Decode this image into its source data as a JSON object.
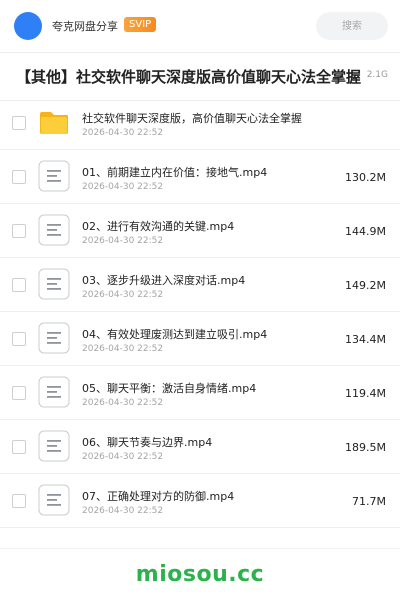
{
  "header": {
    "brand": "夸克网盘分享",
    "badge": "SVIP",
    "search_placeholder": "搜索"
  },
  "title": {
    "text": "【其他】社交软件聊天深度版高价值聊天心法全掌握",
    "total_size": "2.1G"
  },
  "rows": [
    {
      "name": "社交软件聊天深度版，高价值聊天心法全掌握",
      "date": "2026-04-30 22:52",
      "size": "",
      "icon": "folder-icon"
    },
    {
      "name": "01、前期建立内在价值：接地气.mp4",
      "date": "2026-04-30 22:52",
      "size": "130.2M",
      "icon": "document-icon"
    },
    {
      "name": "02、进行有效沟通的关键.mp4",
      "date": "2026-04-30 22:52",
      "size": "144.9M",
      "icon": "document-icon"
    },
    {
      "name": "03、逐步升级进入深度对话.mp4",
      "date": "2026-04-30 22:52",
      "size": "149.2M",
      "icon": "document-icon"
    },
    {
      "name": "04、有效处理废测达到建立吸引.mp4",
      "date": "2026-04-30 22:52",
      "size": "134.4M",
      "icon": "document-icon"
    },
    {
      "name": "05、聊天平衡：激活自身情绪.mp4",
      "date": "2026-04-30 22:52",
      "size": "119.4M",
      "icon": "document-icon"
    },
    {
      "name": "06、聊天节奏与边界.mp4",
      "date": "2026-04-30 22:52",
      "size": "189.5M",
      "icon": "document-icon"
    },
    {
      "name": "07、正确处理对方的防御.mp4",
      "date": "2026-04-30 22:52",
      "size": "71.7M",
      "icon": "document-icon"
    }
  ],
  "watermark": "miosou.cc",
  "colors": {
    "avatar": "#2f80f7",
    "badge": "#f58b1f",
    "folder": "#fbc02d",
    "watermark": "#2bb24c"
  }
}
